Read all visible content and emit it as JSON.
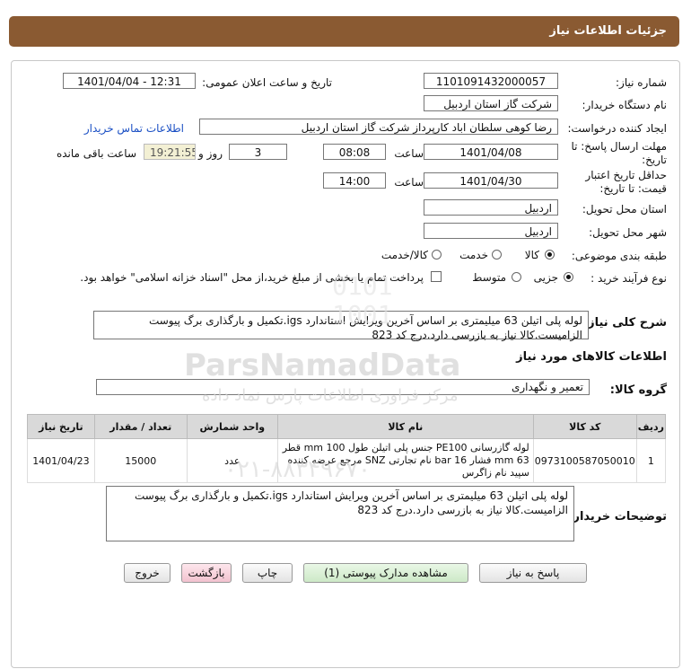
{
  "window": {
    "title": "جزئیات اطلاعات نیاز"
  },
  "fields": {
    "need_number_label": "شماره نیاز:",
    "need_number": "1101091432000057",
    "announce_label": "تاریخ و ساعت اعلان عمومی:",
    "announce_value": "1401/04/04 - 12:31",
    "buyer_label": "نام دستگاه خریدار:",
    "buyer_value": "شرکت گاز استان اردبیل",
    "creator_label": "ایجاد کننده درخواست:",
    "creator_value": "رضا کوهی سلطان اباد کارپرداز شرکت گاز استان اردبیل",
    "contact_link": "اطلاعات تماس خریدار",
    "deadline_label": "مهلت ارسال پاسخ: تا تاریخ:",
    "deadline_date": "1401/04/08",
    "time_label": "ساعت",
    "deadline_time": "08:08",
    "days_value": "3",
    "days_label": "روز و",
    "remaining_value": "19:21:55",
    "remaining_label": "ساعت باقی مانده",
    "validity_label": "حداقل تاریخ اعتبار قیمت: تا تاریخ:",
    "validity_date": "1401/04/30",
    "validity_time": "14:00",
    "province_label": "استان محل تحویل:",
    "province_value": "اردبیل",
    "city_label": "شهر محل تحویل:",
    "city_value": "اردبیل",
    "category_label": "طبقه بندی موضوعی:",
    "category_options": [
      "کالا",
      "خدمت",
      "کالا/خدمت"
    ],
    "category_selected": "کالا",
    "process_label": "نوع فرآیند خرید :",
    "process_options": [
      "جزیی",
      "متوسط"
    ],
    "process_selected": "جزیی",
    "payment_note": "پرداخت تمام یا بخشی از مبلغ خرید،از محل \"اسناد خزانه اسلامی\" خواهد بود."
  },
  "description": {
    "label": "شرح کلی نیاز:",
    "text": "لوله پلی اتیلن 63 میلیمتری بر اساس آخرین ویرایش استاندارد igs.تکمیل و بارگذاری برگ پیوست الزامیست.کالا نیاز به بازرسی دارد.درج کد 823"
  },
  "goods": {
    "section_title": "اطلاعات کالاهای مورد نیاز",
    "group_label": "گروه کالا:",
    "group_value": "تعمیر و نگهداری",
    "columns": [
      "ردیف",
      "کد کالا",
      "نام کالا",
      "واحد شمارش",
      "تعداد / مقدار",
      "تاریخ نیاز"
    ],
    "rows": [
      {
        "row": "1",
        "code": "0973100587050010",
        "name": "لوله گازرسانی PE100 جنس پلی اتیلن طول 100 mm قطر 63 mm فشار 16 bar نام تجارتی SNZ مرجع عرضه کننده سپید نام زاگرس",
        "unit": "عدد",
        "qty": "15000",
        "date": "1401/04/23"
      }
    ]
  },
  "buyer_notes": {
    "label": "توضیحات خریدار:",
    "text": "لوله پلی اتیلن 63 میلیمتری بر اساس آخرین ویرایش استاندارد igs.تکمیل و بارگذاری برگ پیوست الزامیست.کالا نیاز به بازرسی دارد.درج کد 823"
  },
  "buttons": {
    "reply": "پاسخ به نیاز",
    "attachments": "مشاهده مدارک پیوستی (1)",
    "print": "چاپ",
    "back": "بازگشت",
    "exit": "خروج"
  },
  "watermark": {
    "brand": "ParsNamadData",
    "tagline": "مرکز فراوری اطلاعات پارس نماد داده",
    "phone": "۰۲۱-۸۸۳۴۹۶۷۰"
  }
}
